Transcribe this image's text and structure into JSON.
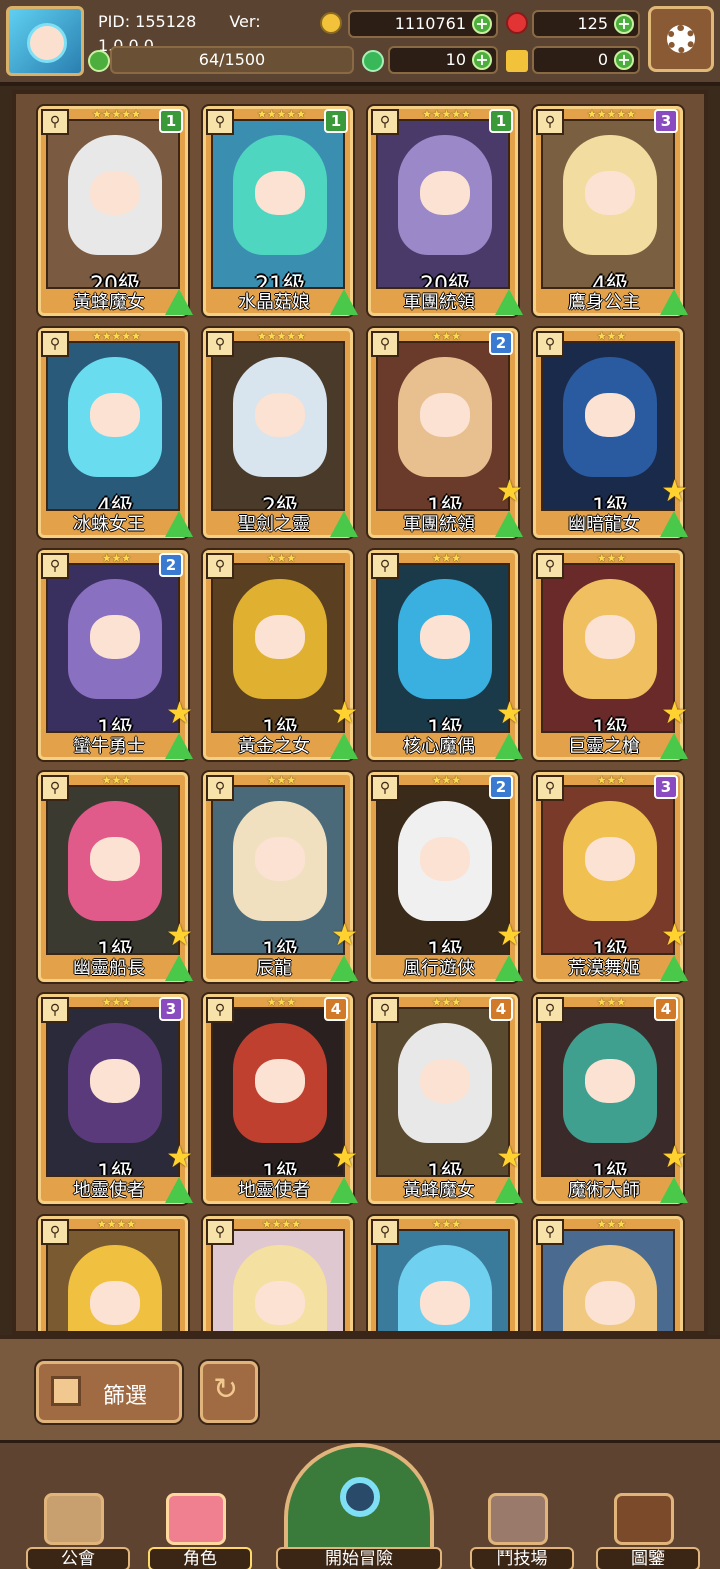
{
  "header": {
    "pid": "PID: 155128",
    "version": "Ver: 1.0.0.0",
    "gold": "1110761",
    "gems": "125",
    "exp": "64/1500",
    "clover": "10",
    "keys": "0"
  },
  "cards": [
    {
      "stars": "★★★★★",
      "level": "20級",
      "name": "黃蜂魔女",
      "badge": "1",
      "hair": "#e8e8e8",
      "bg": "#7a5a40"
    },
    {
      "stars": "★★★★★",
      "level": "21級",
      "name": "水晶菇娘",
      "badge": "1",
      "hair": "#4fd6c0",
      "bg": "#3a8fb0"
    },
    {
      "stars": "★★★★★",
      "level": "20級",
      "name": "軍團統領",
      "badge": "1",
      "hair": "#9a88c8",
      "bg": "#4a3a6a"
    },
    {
      "stars": "★★★★★",
      "level": "4級",
      "name": "鷹身公主",
      "badge": "3",
      "hair": "#f3dca0",
      "bg": "#7a6040"
    },
    {
      "stars": "★★★★★",
      "level": "4級",
      "name": "冰蛛女王",
      "badge": "",
      "hair": "#6adcf0",
      "bg": "#2a5a7a"
    },
    {
      "stars": "★★★★★",
      "level": "2級",
      "name": "聖劍之靈",
      "badge": "",
      "hair": "#d8e4ee",
      "bg": "#4a3a2a"
    },
    {
      "stars": "★★★",
      "level": "1級",
      "name": "軍團統領",
      "badge": "2",
      "hair": "#e8c090",
      "bg": "#6a3a2a"
    },
    {
      "stars": "★★★",
      "level": "1級",
      "name": "幽暗龍女",
      "badge": "",
      "hair": "#2a5aa0",
      "bg": "#1a2a4a"
    },
    {
      "stars": "★★★",
      "level": "1級",
      "name": "蠻牛勇士",
      "badge": "2",
      "hair": "#8a70c0",
      "bg": "#3a3060"
    },
    {
      "stars": "★★★",
      "level": "1級",
      "name": "黃金之女",
      "badge": "",
      "hair": "#e0b030",
      "bg": "#5a4020"
    },
    {
      "stars": "★★★",
      "level": "1級",
      "name": "核心魔偶",
      "badge": "",
      "hair": "#3ab0e0",
      "bg": "#1a3a4a"
    },
    {
      "stars": "★★★",
      "level": "1級",
      "name": "巨靈之槍",
      "badge": "",
      "hair": "#f0c060",
      "bg": "#6a2a2a"
    },
    {
      "stars": "★★★",
      "level": "1級",
      "name": "幽靈船長",
      "badge": "",
      "hair": "#e05a8a",
      "bg": "#3a3a30"
    },
    {
      "stars": "★★★",
      "level": "1級",
      "name": "辰龍",
      "badge": "",
      "hair": "#f0e0c0",
      "bg": "#4a6a7a"
    },
    {
      "stars": "★★★",
      "level": "1級",
      "name": "風行遊俠",
      "badge": "2",
      "hair": "#f0f0f0",
      "bg": "#3a2a1a"
    },
    {
      "stars": "★★★",
      "level": "1級",
      "name": "荒漠舞姬",
      "badge": "3",
      "hair": "#f0c050",
      "bg": "#7a3a2a"
    },
    {
      "stars": "★★★",
      "level": "1級",
      "name": "地靈使者",
      "badge": "3",
      "hair": "#5a3a7a",
      "bg": "#2a2a3a"
    },
    {
      "stars": "★★★",
      "level": "1級",
      "name": "地靈使者",
      "badge": "4",
      "hair": "#c04030",
      "bg": "#2a2020"
    },
    {
      "stars": "★★★",
      "level": "1級",
      "name": "黃蜂魔女",
      "badge": "4",
      "hair": "#e8e8e8",
      "bg": "#5a4a30"
    },
    {
      "stars": "★★★",
      "level": "1級",
      "name": "魔術大師",
      "badge": "4",
      "hair": "#40a090",
      "bg": "#3a2a2a"
    },
    {
      "stars": "★★★★",
      "level": "",
      "name": "",
      "badge": "",
      "hair": "#f0c040",
      "bg": "#7a5a30"
    },
    {
      "stars": "★★★★",
      "level": "",
      "name": "",
      "badge": "",
      "hair": "#f4e0a0",
      "bg": "#e0c8d0"
    },
    {
      "stars": "★★★",
      "level": "",
      "name": "",
      "badge": "",
      "hair": "#70d0f0",
      "bg": "#3a7a9a"
    },
    {
      "stars": "★★★",
      "level": "",
      "name": "",
      "badge": "",
      "hair": "#f0c880",
      "bg": "#4a6a90"
    }
  ],
  "controls": {
    "filter_label": "篩選"
  },
  "nav": [
    {
      "label": "公會"
    },
    {
      "label": "角色"
    },
    {
      "label": "開始冒險"
    },
    {
      "label": "鬥技場"
    },
    {
      "label": "圖鑒"
    }
  ]
}
